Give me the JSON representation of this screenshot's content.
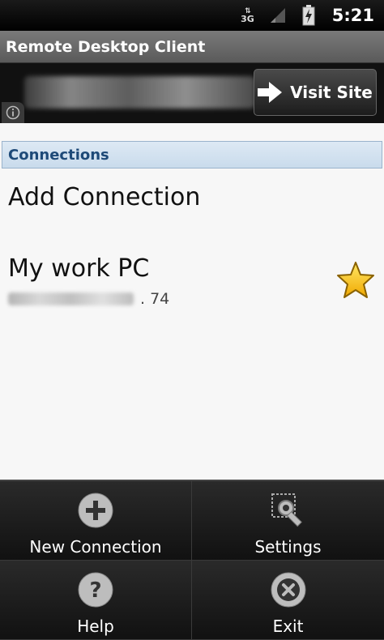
{
  "status_bar": {
    "network": "3G",
    "time": "5:21"
  },
  "title_bar": {
    "title": "Remote Desktop Client"
  },
  "banner": {
    "visit_label": "Visit Site"
  },
  "connections": {
    "section_title": "Connections",
    "add_label": "Add Connection",
    "items": [
      {
        "name": "My work PC",
        "host_suffix": ". 74",
        "favorite": true
      }
    ]
  },
  "menu": {
    "items": [
      {
        "label": "New Connection",
        "icon": "plus-icon"
      },
      {
        "label": "Settings",
        "icon": "settings-icon"
      },
      {
        "label": "Help",
        "icon": "help-icon"
      },
      {
        "label": "Exit",
        "icon": "close-icon"
      }
    ]
  }
}
